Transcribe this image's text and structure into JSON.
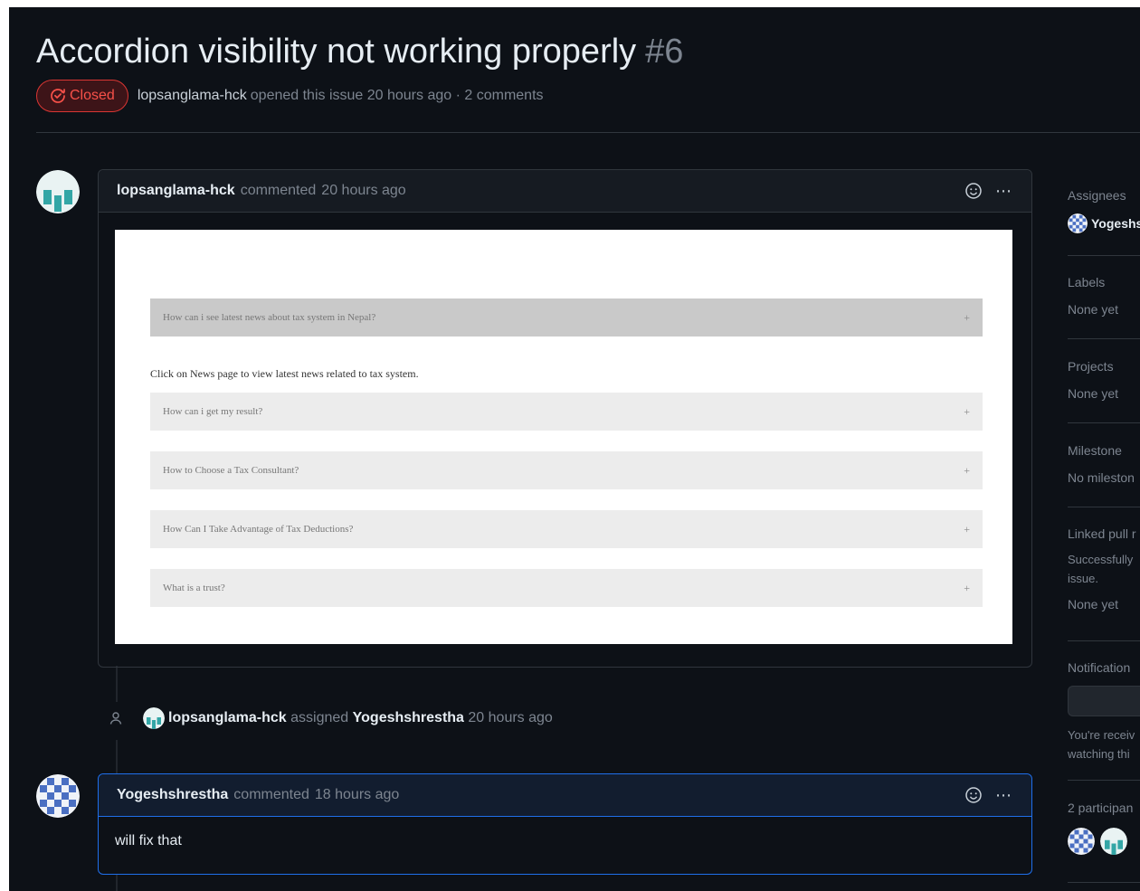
{
  "issue": {
    "title": "Accordion visibility not working properly",
    "number": "#6",
    "state": "Closed",
    "author": "lopsanglama-hck",
    "meta_text": "opened this issue 20 hours ago · 2 comments"
  },
  "comments": [
    {
      "author": "lopsanglama-hck",
      "verb": "commented",
      "time": "20 hours ago",
      "screenshot": {
        "items": [
          "How can i see latest news about tax system in Nepal?",
          "How can i get my result?",
          "How to Choose a Tax Consultant?",
          "How Can I Take Advantage of Tax Deductions?",
          "What is a trust?"
        ],
        "open_answer": "Click on News page to view latest news related to tax system.",
        "plus": "+"
      }
    },
    {
      "author": "Yogeshshrestha",
      "verb": "commented",
      "time": "18 hours ago",
      "body": "will fix that"
    }
  ],
  "event": {
    "actor": "lopsanglama-hck",
    "action": "assigned",
    "target": "Yogeshshrestha",
    "time": "20 hours ago"
  },
  "sidebar": {
    "assignees_label": "Assignees",
    "assignee": "Yogeshs",
    "labels_label": "Labels",
    "labels_value": "None yet",
    "projects_label": "Projects",
    "projects_value": "None yet",
    "milestone_label": "Milestone",
    "milestone_value": "No mileston",
    "linked_label": "Linked pull r",
    "linked_desc_1": "Successfully",
    "linked_desc_2": "issue.",
    "linked_value": "None yet",
    "notifications_label": "Notification",
    "notif_desc_1": "You're receiv",
    "notif_desc_2": "watching thi",
    "participants_label": "2 participan"
  },
  "icons": {
    "closed": "issue-closed-icon",
    "smiley": "smiley-icon",
    "kebab": "kebab-icon",
    "person": "person-icon"
  },
  "colors": {
    "background": "#0d1117",
    "closed_red": "#f85149",
    "accent_blue": "#1f6feb"
  }
}
